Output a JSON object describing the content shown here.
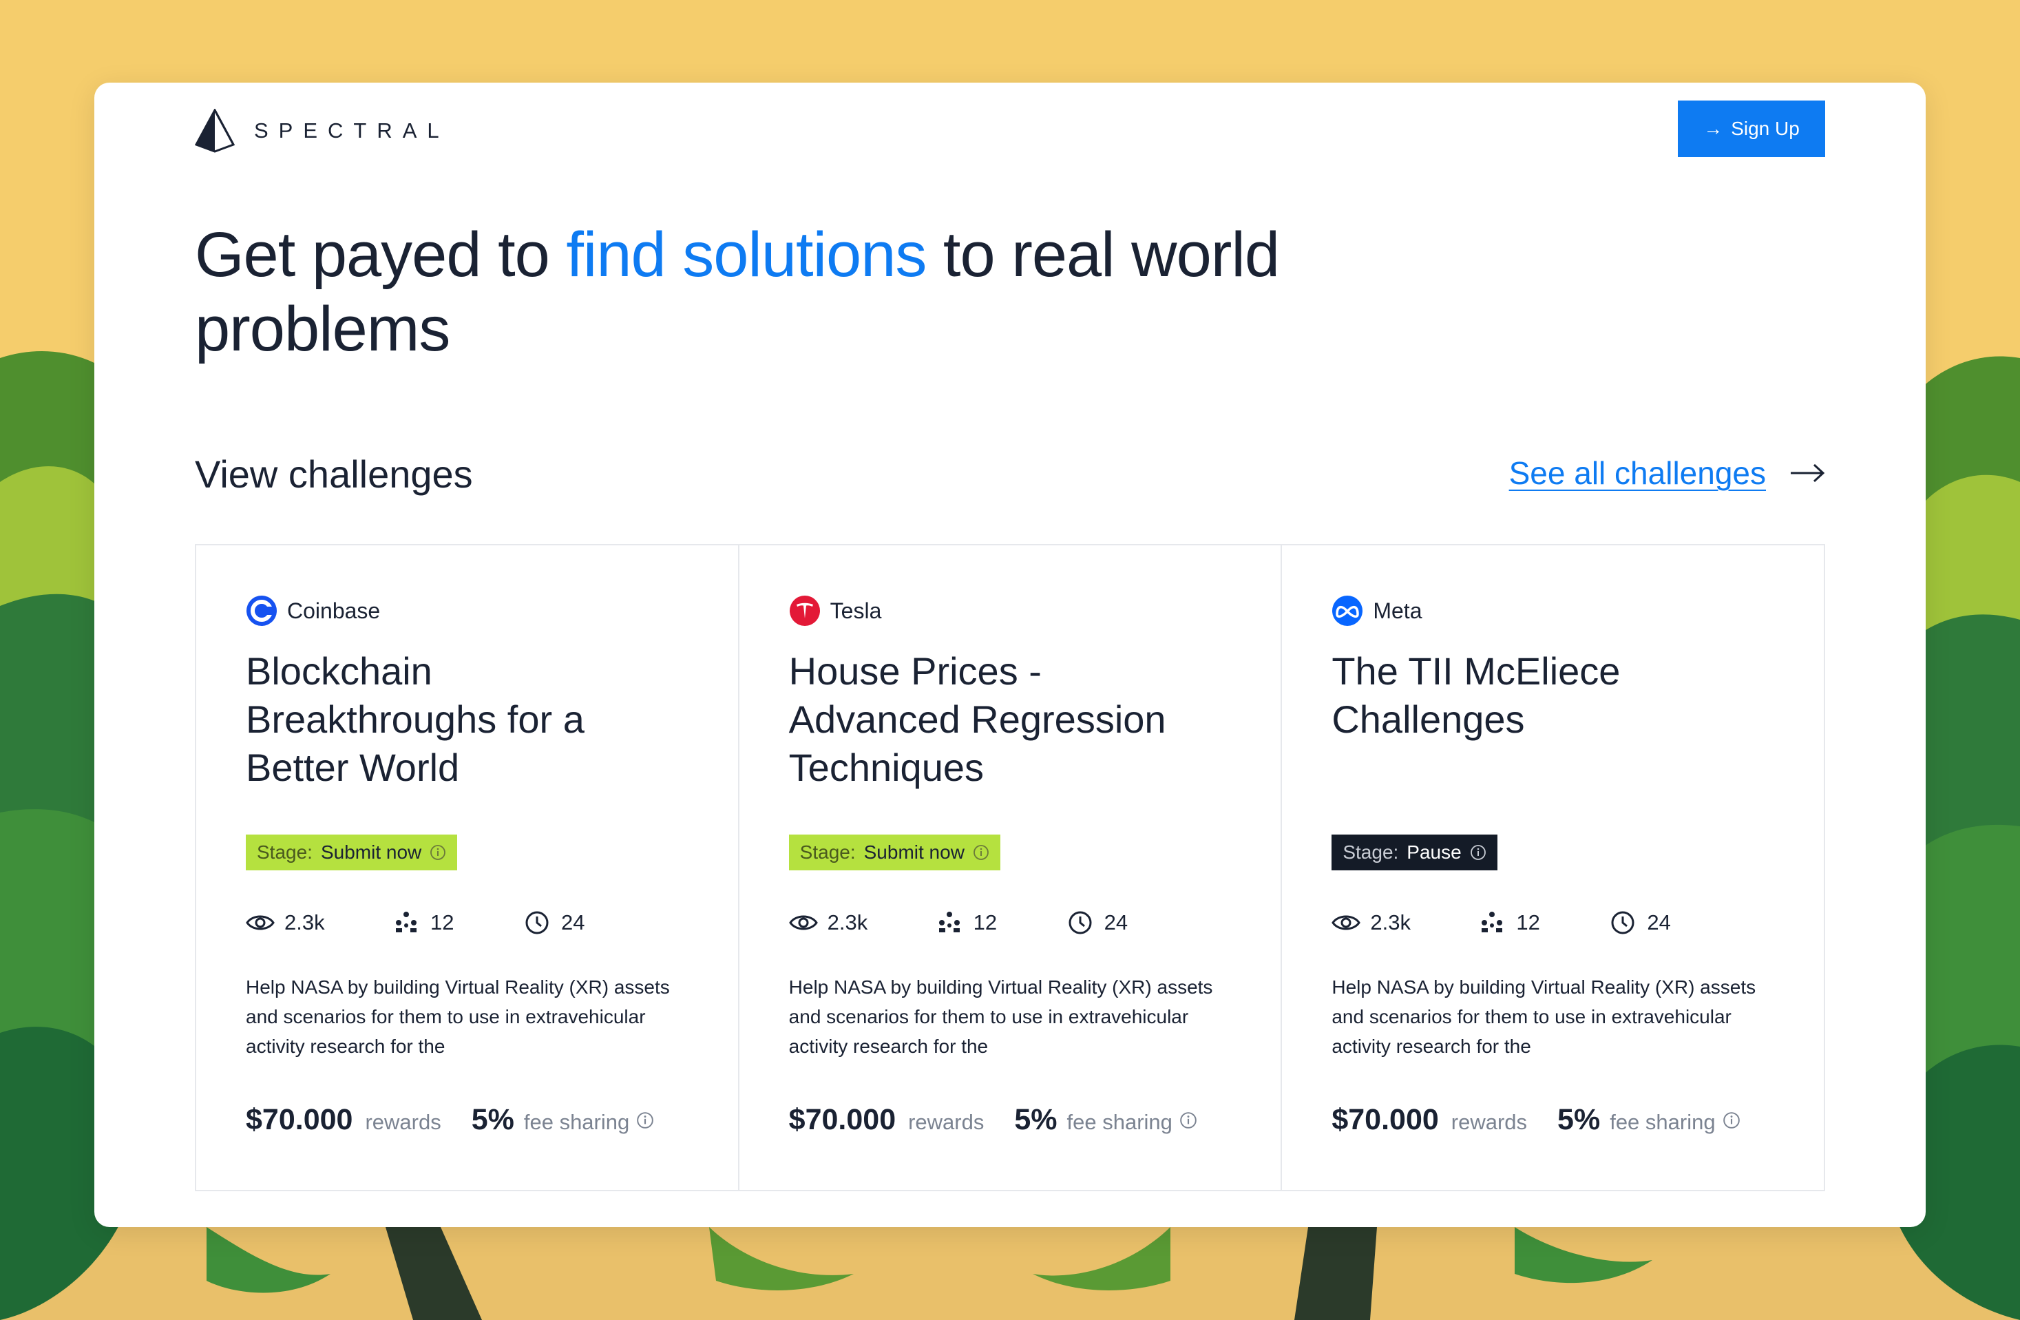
{
  "brand": {
    "name": "SPECTRAL"
  },
  "header": {
    "signup_label": "Sign Up"
  },
  "hero": {
    "part1": "Get payed to ",
    "accent": "find solutions",
    "part2": " to real world problems"
  },
  "section": {
    "title": "View challenges",
    "see_all_label": "See all challenges"
  },
  "colors": {
    "accent": "#0e7bf2",
    "stage_submit": "#b5e13f",
    "stage_pause": "#141b27",
    "coinbase": "#1652f0",
    "tesla": "#e31937",
    "meta": "#0866ff"
  },
  "challenges": [
    {
      "company": "Coinbase",
      "logo_icon": "coinbase-logo",
      "title": "Blockchain Breakthroughs for a Better World",
      "stage_key": "Stage:",
      "stage_value": "Submit now",
      "views": "2.3k",
      "participants": "12",
      "time": "24",
      "description": "Help NASA by building Virtual Reality (XR) assets and scenarios for them to use in extravehicular activity research for the",
      "reward": "$70.000",
      "reward_label": "rewards",
      "fee": "5%",
      "fee_label": "fee sharing"
    },
    {
      "company": "Tesla",
      "logo_icon": "tesla-logo",
      "title": "House Prices - Advanced Regression Techniques",
      "stage_key": "Stage:",
      "stage_value": "Submit now",
      "views": "2.3k",
      "participants": "12",
      "time": "24",
      "description": "Help NASA by building Virtual Reality (XR) assets and scenarios for them to use in extravehicular activity research for the",
      "reward": "$70.000",
      "reward_label": "rewards",
      "fee": "5%",
      "fee_label": "fee sharing"
    },
    {
      "company": "Meta",
      "logo_icon": "meta-logo",
      "title": "The TII McEliece Challenges",
      "stage_key": "Stage:",
      "stage_value": "Pause",
      "views": "2.3k",
      "participants": "12",
      "time": "24",
      "description": "Help NASA by building Virtual Reality (XR) assets and scenarios for them to use in extravehicular activity research for the",
      "reward": "$70.000",
      "reward_label": "rewards",
      "fee": "5%",
      "fee_label": "fee sharing"
    }
  ]
}
